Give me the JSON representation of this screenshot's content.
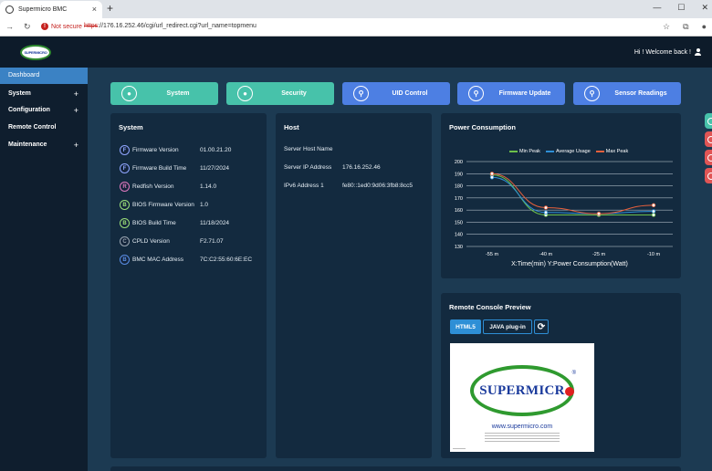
{
  "browser": {
    "tab_title": "Supermicro BMC",
    "tab_close": "×",
    "new_tab": "+",
    "not_secure": "Not secure",
    "url_scheme": "https",
    "url_rest": "://176.16.252.46/cgi/url_redirect.cgi?url_name=topmenu",
    "window_controls": [
      "—",
      "☐",
      "✕"
    ]
  },
  "header": {
    "logo_text": "SUPERMICRO",
    "welcome": "Hi ! Welcome back !"
  },
  "sidebar": {
    "items": [
      {
        "label": "Dashboard",
        "has_plus": false,
        "active": true
      },
      {
        "label": "System",
        "has_plus": true
      },
      {
        "label": "Configuration",
        "has_plus": true
      },
      {
        "label": "Remote Control",
        "has_plus": false
      },
      {
        "label": "Maintenance",
        "has_plus": true
      }
    ]
  },
  "quick_buttons": [
    {
      "label": "System",
      "icon": "chat-bubble-icon",
      "color": "#47c2aa"
    },
    {
      "label": "Security",
      "icon": "chat-bubble-icon",
      "color": "#47c2aa"
    },
    {
      "label": "UID Control",
      "icon": "link-icon",
      "color": "#4d7fe3"
    },
    {
      "label": "Firmware Update",
      "icon": "link-icon",
      "color": "#4d7fe3"
    },
    {
      "label": "Sensor Readings",
      "icon": "link-icon",
      "color": "#4d7fe3"
    }
  ],
  "system_card": {
    "title": "System",
    "rows": [
      {
        "icon": "F",
        "color": "#8fa6ff",
        "label": "Firmware Version",
        "value": "01.00.21.20"
      },
      {
        "icon": "F",
        "color": "#8fa6ff",
        "label": "Firmware Build Time",
        "value": "11/27/2024"
      },
      {
        "icon": "R",
        "color": "#e07ac0",
        "label": "Redfish Version",
        "value": "1.14.0"
      },
      {
        "icon": "B",
        "color": "#9be07a",
        "label": "BIOS Firmware Version",
        "value": "1.0"
      },
      {
        "icon": "B",
        "color": "#9be07a",
        "label": "BIOS Build Time",
        "value": "11/18/2024"
      },
      {
        "icon": "C",
        "color": "#9aa6b2",
        "label": "CPLD Version",
        "value": "F2.71.07"
      },
      {
        "icon": "B",
        "color": "#5a8fe6",
        "label": "BMC MAC Address",
        "value": "7C:C2:55:60:6E:EC"
      }
    ]
  },
  "host_card": {
    "title": "Host",
    "rows": [
      {
        "label": "Server Host Name",
        "value": ""
      },
      {
        "label": "Server IP Address",
        "value": "176.16.252.46"
      },
      {
        "label": "IPv6 Address 1",
        "value": "fe80::1ed0:9d06:3fb8:8cc5"
      }
    ]
  },
  "power_card": {
    "title": "Power Consumption"
  },
  "chart_data": {
    "type": "line",
    "title": "",
    "xlabel": "X:Time(min) Y:Power Consumption(Watt)",
    "ylabel": "",
    "categories": [
      "-55 m",
      "-40 m",
      "-25 m",
      "-10 m"
    ],
    "ylim": [
      130,
      200
    ],
    "yticks": [
      130,
      140,
      150,
      160,
      170,
      180,
      190,
      200
    ],
    "grid": true,
    "legend_position": "top",
    "series": [
      {
        "name": "Min Peak",
        "color": "#6cc04a",
        "values": [
          189,
          156,
          156,
          156
        ]
      },
      {
        "name": "Average Usage",
        "color": "#2e8fd6",
        "values": [
          187,
          158,
          157,
          159
        ]
      },
      {
        "name": "Max Peak",
        "color": "#e8603c",
        "values": [
          190,
          162,
          157,
          164
        ]
      }
    ]
  },
  "remote_console": {
    "title": "Remote Console Preview",
    "html5_label": "HTML5",
    "java_label": "JAVA plug-in",
    "refresh_icon": "refresh-icon",
    "preview_logo": "SUPERMICR",
    "preview_reg": "®",
    "preview_url": "www.supermicro.com"
  },
  "right_tab_colors": [
    "#47c2aa",
    "#e05555",
    "#e05555",
    "#e05555"
  ]
}
